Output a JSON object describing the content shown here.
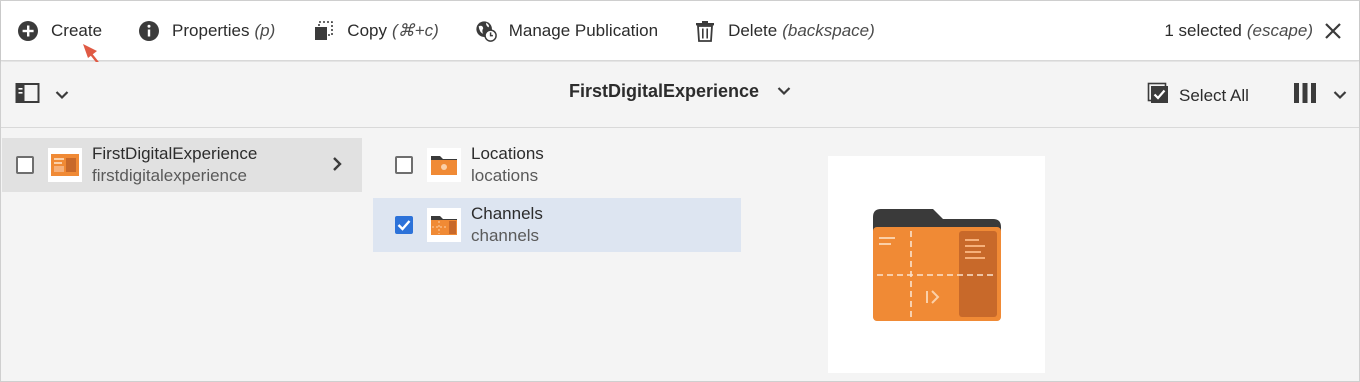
{
  "actionbar": {
    "create": {
      "label": "Create",
      "icon": "plus-circle-icon"
    },
    "properties": {
      "label": "Properties",
      "shortcut": "(p)",
      "icon": "info-icon"
    },
    "copy": {
      "label": "Copy",
      "shortcut": "(⌘+c)",
      "icon": "copy-icon"
    },
    "manage_publication": {
      "label": "Manage Publication",
      "icon": "globe-clock-icon"
    },
    "delete": {
      "label": "Delete",
      "shortcut": "(backspace)",
      "icon": "trash-icon"
    },
    "selection": {
      "count_label": "1 selected",
      "shortcut": "(escape)",
      "close_icon": "close-icon"
    }
  },
  "titlebar": {
    "rail_toggle_icon": "rail-panel-icon",
    "title": "FirstDigitalExperience",
    "select_all_label": "Select All",
    "view_icon": "column-view-icon"
  },
  "columns": {
    "first": [
      {
        "title": "FirstDigitalExperience",
        "name": "firstdigitalexperience",
        "checked": false,
        "active": true
      }
    ],
    "second": [
      {
        "title": "Locations",
        "name": "locations",
        "checked": false
      },
      {
        "title": "Channels",
        "name": "channels",
        "checked": true
      }
    ]
  },
  "colors": {
    "accent_blue": "#2c72d9",
    "folder_orange": "#f08a35",
    "folder_dark": "#3a3a3a",
    "selected_row": "#dde5f1",
    "active_row": "#e1e1e1"
  },
  "preview": {
    "icon": "channel-folder-icon"
  }
}
